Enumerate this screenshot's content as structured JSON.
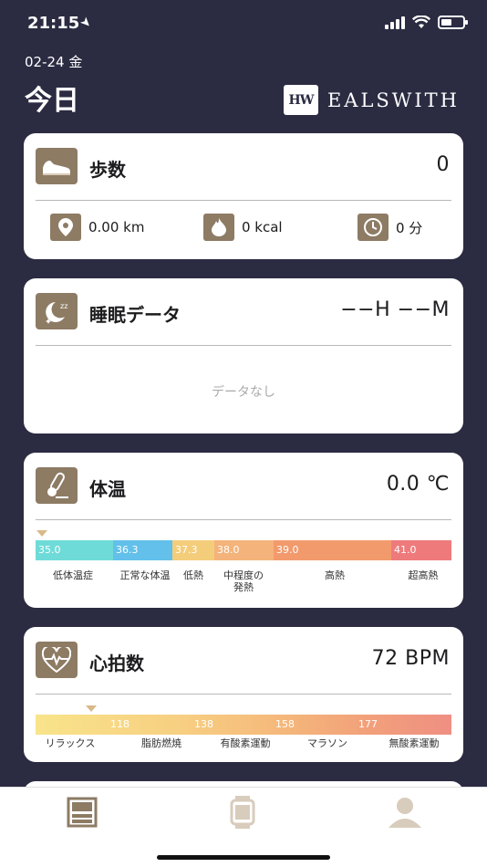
{
  "status": {
    "time": "21:15"
  },
  "header": {
    "date": "02-24 金",
    "title": "今日",
    "brand_mark": "HW",
    "brand_name": "EALSWITH"
  },
  "steps": {
    "title": "歩数",
    "value": "0",
    "icon": "shoe-icon",
    "distance": "0.00 km",
    "calories": "0 kcal",
    "duration": "0 分"
  },
  "sleep": {
    "title": "睡眠データ",
    "value": "−−H −−M",
    "empty": "データなし",
    "icon": "moon-icon"
  },
  "temperature": {
    "title": "体温",
    "value": "0.0 ℃",
    "icon": "thermometer-icon",
    "ticks": [
      "35.0",
      "36.3",
      "37.3",
      "38.0",
      "39.0",
      "41.0"
    ],
    "labels": [
      "低体温症",
      "正常な体温",
      "低熱",
      "中程度の\n発熱",
      "高熱",
      "超高熱"
    ],
    "colors": [
      "#6fdbd8",
      "#62c0ea",
      "#f4cd7a",
      "#f4b37a",
      "#f29a6c",
      "#ee7a7c"
    ]
  },
  "heart_rate": {
    "title": "心拍数",
    "value": "72 BPM",
    "icon": "heart-icon",
    "ticks": [
      "118",
      "138",
      "158",
      "177"
    ],
    "labels": [
      "リラックス",
      "脂肪燃焼",
      "有酸素運動",
      "マラソン",
      "無酸素運動"
    ]
  },
  "tabs": [
    "today-tab",
    "device-tab",
    "profile-tab"
  ]
}
